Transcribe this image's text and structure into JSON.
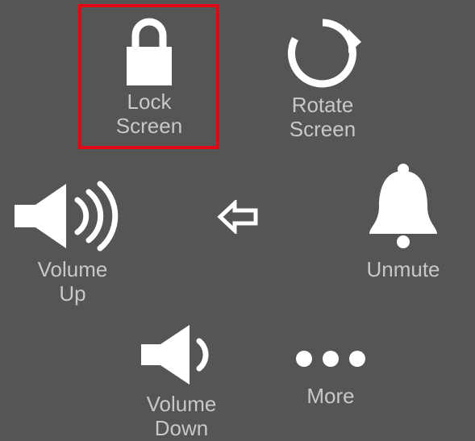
{
  "items": {
    "lock_screen": {
      "label": "Lock\nScreen"
    },
    "rotate_screen": {
      "label": "Rotate\nScreen"
    },
    "volume_up": {
      "label": "Volume\nUp"
    },
    "unmute": {
      "label": "Unmute"
    },
    "volume_down": {
      "label": "Volume\nDown"
    },
    "more": {
      "label": "More"
    },
    "back": {
      "label": ""
    }
  },
  "highlighted": "lock_screen"
}
